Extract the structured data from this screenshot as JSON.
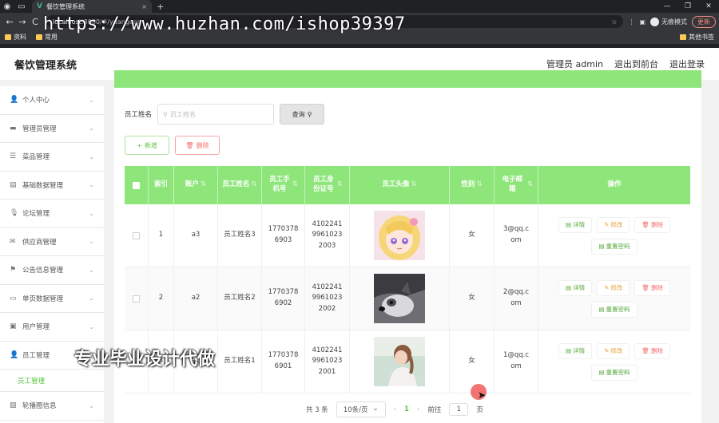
{
  "browser": {
    "tab_title": "餐饮管理系统",
    "tab_close": "×",
    "new_tab": "+",
    "back": "←",
    "forward": "→",
    "reload": "C",
    "url_host": "localhost",
    "url_rest": ":8080/#/yuangong",
    "incognito_label": "无痕模式",
    "update_label": "更新",
    "bookmarks": [
      "资料",
      "常用"
    ],
    "bookmark_other": "其他书签"
  },
  "watermark_url": "https://www.huzhan.com/ishop39397",
  "watermark_cn": "专业毕业设计代做",
  "app": {
    "title": "餐饮管理系统",
    "header_links": [
      "管理员 admin",
      "退出到前台",
      "退出登录"
    ]
  },
  "sidebar": {
    "items": [
      {
        "label": "个人中心",
        "icon": "person-icon"
      },
      {
        "label": "管理员管理",
        "icon": "chat-icon"
      },
      {
        "label": "菜品管理",
        "icon": "menu-icon"
      },
      {
        "label": "基础数据管理",
        "icon": "database-icon"
      },
      {
        "label": "论坛管理",
        "icon": "mic-icon"
      },
      {
        "label": "供应商管理",
        "icon": "mail-icon"
      },
      {
        "label": "公告信息管理",
        "icon": "flag-icon"
      },
      {
        "label": "单页数据管理",
        "icon": "card-icon"
      },
      {
        "label": "用户管理",
        "icon": "monitor-icon"
      },
      {
        "label": "员工管理",
        "icon": "person-icon"
      },
      {
        "label": "轮播图信息",
        "icon": "image-icon"
      }
    ],
    "active_sub": "员工管理"
  },
  "search": {
    "label": "员工姓名",
    "placeholder": "员工姓名",
    "button": "查询"
  },
  "actions": {
    "add": "新增",
    "delete": "删除"
  },
  "table": {
    "headers": [
      "索引",
      "账户",
      "员工姓名",
      "员工手机号",
      "员工身份证号",
      "员工头像",
      "性别",
      "电子邮箱",
      "操作"
    ],
    "rows": [
      {
        "index": "1",
        "account": "a3",
        "name": "员工姓名3",
        "phone": "17703786903",
        "idcard": "410224199610232003",
        "gender": "女",
        "email": "3@qq.com"
      },
      {
        "index": "2",
        "account": "a2",
        "name": "员工姓名2",
        "phone": "17703786902",
        "idcard": "410224199610232002",
        "gender": "女",
        "email": "2@qq.com"
      },
      {
        "index": "3",
        "account": "a1",
        "name": "员工姓名1",
        "phone": "17703786901",
        "idcard": "410224199610232001",
        "gender": "女",
        "email": "1@qq.com"
      }
    ],
    "ops": {
      "detail": "详情",
      "edit": "修改",
      "delete": "删除",
      "reset": "重置密码"
    }
  },
  "pager": {
    "total": "共 3 条",
    "page_size": "10条/页",
    "current": "1",
    "goto_prefix": "前往",
    "goto_value": "1",
    "goto_suffix": "页"
  }
}
